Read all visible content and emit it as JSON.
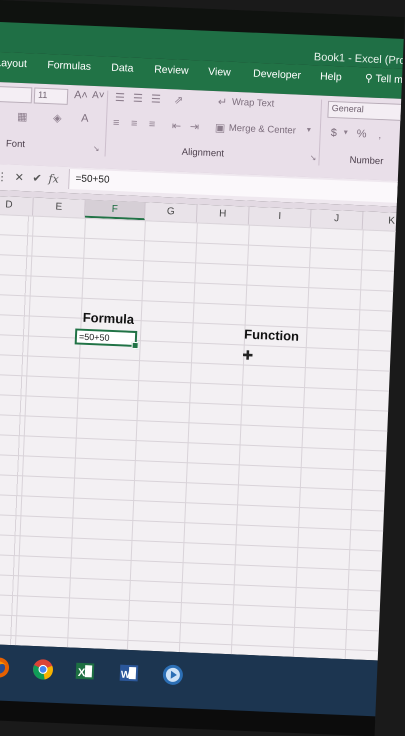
{
  "window": {
    "title": "Book1 - Excel (Pro"
  },
  "ribbon_tabs": [
    "Layout",
    "Formulas",
    "Data",
    "Review",
    "View",
    "Developer",
    "Help"
  ],
  "tell_me": "Tell m",
  "ribbon": {
    "font_size": "11",
    "grow_font": "A˄",
    "shrink_font": "A˅",
    "font_color": "A",
    "wrap_text": "Wrap Text",
    "merge_center": "Merge & Center",
    "number_format": "General",
    "currency_symbol": "$",
    "percent_symbol": "%",
    "groups": {
      "font": "Font",
      "alignment": "Alignment",
      "number": "Number"
    }
  },
  "formula_bar": {
    "cancel": "✕",
    "enter": "✔",
    "fx": "fx",
    "value": "=50+50"
  },
  "columns": [
    "D",
    "E",
    "F",
    "G",
    "H",
    "I",
    "J",
    "K"
  ],
  "selected_column": "F",
  "cells": {
    "formula_header": "Formula",
    "function_header": "Function",
    "active_cell_value": "=50+50"
  },
  "taskbar": [
    "firefox-icon",
    "chrome-icon",
    "excel-icon",
    "word-icon",
    "media-player-icon"
  ],
  "colors": {
    "excel_green": "#217346",
    "taskbar": "#1c3550"
  }
}
